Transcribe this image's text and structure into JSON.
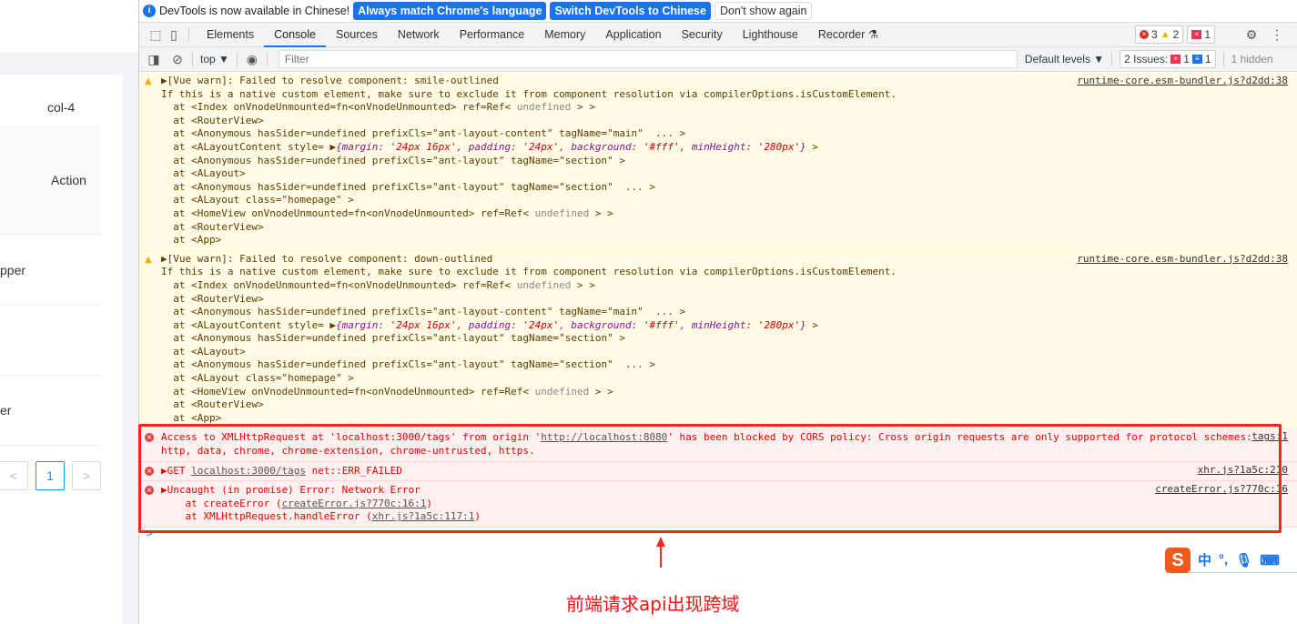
{
  "left_page": {
    "col_header": "col-4",
    "action_header": "Action",
    "row1": "pper",
    "row3": "er",
    "pagination": {
      "prev": "<",
      "current": "1",
      "next": ">"
    }
  },
  "infobar": {
    "message": "DevTools is now available in Chinese!",
    "btn_match": "Always match Chrome's language",
    "btn_switch": "Switch DevTools to Chinese",
    "btn_dismiss": "Don't show again"
  },
  "tabs": [
    {
      "label": "Elements"
    },
    {
      "label": "Console",
      "active": true
    },
    {
      "label": "Sources"
    },
    {
      "label": "Network"
    },
    {
      "label": "Performance"
    },
    {
      "label": "Memory"
    },
    {
      "label": "Application"
    },
    {
      "label": "Security"
    },
    {
      "label": "Lighthouse"
    },
    {
      "label": "Recorder ⚗"
    }
  ],
  "counts": {
    "errors": "3",
    "warnings": "2",
    "issues": "1"
  },
  "toolbar": {
    "context": "top ▼",
    "filter_placeholder": "Filter",
    "levels": "Default levels ▼",
    "issues_label": "2 Issues:",
    "issues_err": "1",
    "issues_info": "1",
    "hidden": "1 hidden"
  },
  "messages": [
    {
      "type": "warn",
      "source": "runtime-core.esm-bundler.js?d2dd:38",
      "lines": [
        [
          {
            "t": "▶[Vue warn]: Failed to resolve component: smile-outlined"
          }
        ],
        [
          {
            "t": "If this is a native custom element, make sure to exclude it from component resolution via compilerOptions.isCustomElement."
          }
        ],
        [
          {
            "t": "  at <Index onVnodeUnmounted=fn<onVnodeUnmounted> ref=Ref< "
          },
          {
            "t": "undefined",
            "c": "g"
          },
          {
            "t": " > >"
          }
        ],
        [
          {
            "t": "  at <RouterView>"
          }
        ],
        [
          {
            "t": "  at <Anonymous hasSider=undefined prefixCls=\"ant-layout-content\" tagName=\"main\"  ... >"
          }
        ],
        [
          {
            "t": "  at <ALayoutContent style= ▶"
          },
          {
            "t": "{margin: ",
            "c": "k"
          },
          {
            "t": "'24px 16px'",
            "c": "s"
          },
          {
            "t": ", padding: ",
            "c": "k"
          },
          {
            "t": "'24px'",
            "c": "s"
          },
          {
            "t": ", background: ",
            "c": "k"
          },
          {
            "t": "'#fff'",
            "c": "s"
          },
          {
            "t": ", minHeight: ",
            "c": "k"
          },
          {
            "t": "'280px'",
            "c": "s"
          },
          {
            "t": "}",
            "c": "k"
          },
          {
            "t": " >"
          }
        ],
        [
          {
            "t": "  at <Anonymous hasSider=undefined prefixCls=\"ant-layout\" tagName=\"section\" >"
          }
        ],
        [
          {
            "t": "  at <ALayout>"
          }
        ],
        [
          {
            "t": "  at <Anonymous hasSider=undefined prefixCls=\"ant-layout\" tagName=\"section\"  ... >"
          }
        ],
        [
          {
            "t": "  at <ALayout class=\"homepage\" >"
          }
        ],
        [
          {
            "t": "  at <HomeView onVnodeUnmounted=fn<onVnodeUnmounted> ref=Ref< "
          },
          {
            "t": "undefined",
            "c": "g"
          },
          {
            "t": " > >"
          }
        ],
        [
          {
            "t": "  at <RouterView>"
          }
        ],
        [
          {
            "t": "  at <App>"
          }
        ]
      ]
    },
    {
      "type": "warn",
      "source": "runtime-core.esm-bundler.js?d2dd:38",
      "lines": [
        [
          {
            "t": "▶[Vue warn]: Failed to resolve component: down-outlined"
          }
        ],
        [
          {
            "t": "If this is a native custom element, make sure to exclude it from component resolution via compilerOptions.isCustomElement."
          }
        ],
        [
          {
            "t": "  at <Index onVnodeUnmounted=fn<onVnodeUnmounted> ref=Ref< "
          },
          {
            "t": "undefined",
            "c": "g"
          },
          {
            "t": " > >"
          }
        ],
        [
          {
            "t": "  at <RouterView>"
          }
        ],
        [
          {
            "t": "  at <Anonymous hasSider=undefined prefixCls=\"ant-layout-content\" tagName=\"main\"  ... >"
          }
        ],
        [
          {
            "t": "  at <ALayoutContent style= ▶"
          },
          {
            "t": "{margin: ",
            "c": "k"
          },
          {
            "t": "'24px 16px'",
            "c": "s"
          },
          {
            "t": ", padding: ",
            "c": "k"
          },
          {
            "t": "'24px'",
            "c": "s"
          },
          {
            "t": ", background: ",
            "c": "k"
          },
          {
            "t": "'#fff'",
            "c": "s"
          },
          {
            "t": ", minHeight: ",
            "c": "k"
          },
          {
            "t": "'280px'",
            "c": "s"
          },
          {
            "t": "}",
            "c": "k"
          },
          {
            "t": " >"
          }
        ],
        [
          {
            "t": "  at <Anonymous hasSider=undefined prefixCls=\"ant-layout\" tagName=\"section\" >"
          }
        ],
        [
          {
            "t": "  at <ALayout>"
          }
        ],
        [
          {
            "t": "  at <Anonymous hasSider=undefined prefixCls=\"ant-layout\" tagName=\"section\"  ... >"
          }
        ],
        [
          {
            "t": "  at <ALayout class=\"homepage\" >"
          }
        ],
        [
          {
            "t": "  at <HomeView onVnodeUnmounted=fn<onVnodeUnmounted> ref=Ref< "
          },
          {
            "t": "undefined",
            "c": "g"
          },
          {
            "t": " > >"
          }
        ],
        [
          {
            "t": "  at <RouterView>"
          }
        ],
        [
          {
            "t": "  at <App>"
          }
        ]
      ]
    },
    {
      "type": "err",
      "source": "tags:1",
      "lines": [
        [
          {
            "t": "Access to XMLHttpRequest at 'localhost:3000/tags' from origin '"
          },
          {
            "t": "http://localhost:8080",
            "c": "u"
          },
          {
            "t": "' has been blocked by CORS policy: Cross origin requests are only supported for protocol schemes:"
          }
        ],
        [
          {
            "t": "http, data, chrome, chrome-extension, chrome-untrusted, https."
          }
        ]
      ]
    },
    {
      "type": "err",
      "source": "xhr.js?1a5c:210",
      "lines": [
        [
          {
            "t": "▶GET "
          },
          {
            "t": "localhost:3000/tags",
            "c": "u"
          },
          {
            "t": " net::ERR_FAILED"
          }
        ]
      ]
    },
    {
      "type": "err",
      "source": "createError.js?770c:16",
      "lines": [
        [
          {
            "t": "▶Uncaught (in promise) Error: Network Error"
          }
        ],
        [
          {
            "t": "    at createError ("
          },
          {
            "t": "createError.js?770c:16:1",
            "c": "u"
          },
          {
            "t": ")"
          }
        ],
        [
          {
            "t": "    at XMLHttpRequest.handleError ("
          },
          {
            "t": "xhr.js?1a5c:117:1",
            "c": "u"
          },
          {
            "t": ")"
          }
        ]
      ]
    }
  ],
  "prompt": ">",
  "ime": {
    "lang": "中",
    "punct": "°,"
  },
  "annotation": {
    "caption": "前端请求api出现跨域",
    "color": "#f22222"
  }
}
